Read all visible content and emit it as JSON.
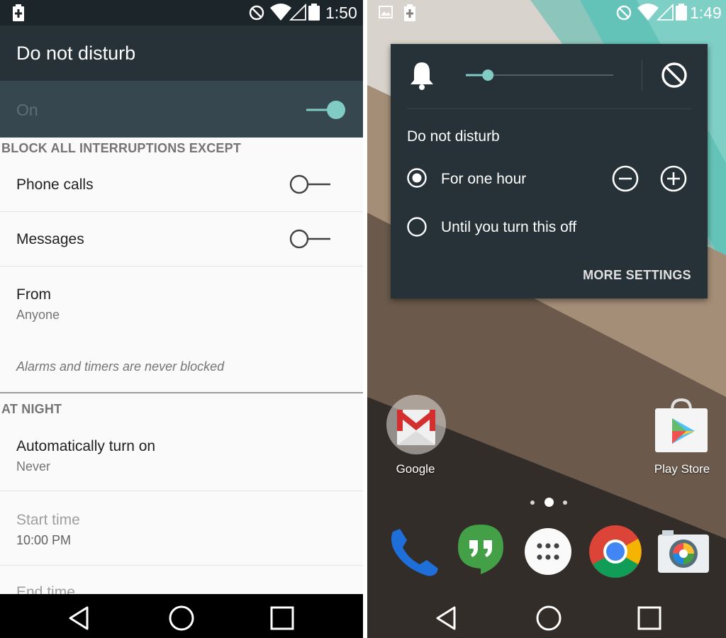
{
  "left_screen": {
    "status_bar": {
      "time": "1:50"
    },
    "app_bar": {
      "title": "Do not disturb"
    },
    "master_switch": {
      "label": "On",
      "state": "on"
    },
    "section_interruptions": {
      "header": "BLOCK ALL INTERRUPTIONS EXCEPT"
    },
    "phone_calls": {
      "label": "Phone calls",
      "state": "off"
    },
    "messages": {
      "label": "Messages",
      "state": "off"
    },
    "from": {
      "label": "From",
      "value": "Anyone"
    },
    "note": "Alarms and timers are never blocked",
    "section_night": {
      "header": "AT NIGHT"
    },
    "auto_on": {
      "label": "Automatically turn on",
      "value": "Never"
    },
    "start_time": {
      "label": "Start time",
      "value": "10:00 PM"
    },
    "end_time": {
      "label": "End time"
    },
    "nav_bar": {
      "icons": [
        "back-icon",
        "home-icon",
        "recents-icon"
      ]
    }
  },
  "right_screen": {
    "status_bar": {
      "time": "1:49"
    },
    "dnd_panel": {
      "volume_fraction": 0.15,
      "title": "Do not disturb",
      "options": [
        {
          "label": "For one hour",
          "selected": true
        },
        {
          "label": "Until you turn this off",
          "selected": false
        }
      ],
      "more_settings": "MORE SETTINGS"
    },
    "home": {
      "apps": [
        {
          "label": "Google",
          "icon": "gmail-folder-icon"
        },
        {
          "label": "Play Store",
          "icon": "play-store-icon"
        }
      ],
      "page_indicator": {
        "pages": 3,
        "current": 2
      },
      "dock": [
        "phone-icon",
        "hangouts-icon",
        "app-drawer-icon",
        "chrome-icon",
        "camera-icon"
      ]
    },
    "nav_bar": {
      "icons": [
        "back-icon",
        "home-icon",
        "recents-icon"
      ]
    }
  },
  "colors": {
    "accent": "#80cbc4",
    "panel": "#263238",
    "appbar": "#263238"
  }
}
